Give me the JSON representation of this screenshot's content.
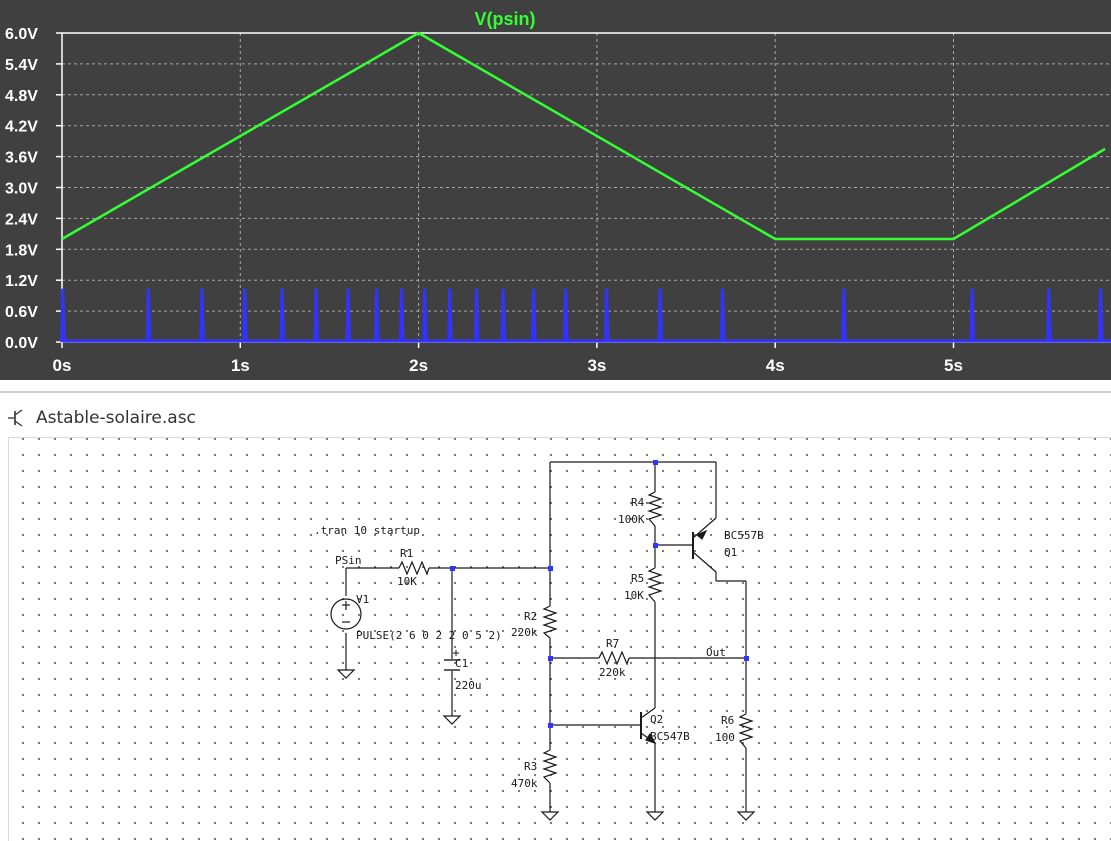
{
  "waveform_viewer": {
    "trace_title": "V(psin)",
    "background_color": "#404040",
    "trace_color": "#33ff33",
    "pulse_color": "#3333ff",
    "chart_data": {
      "type": "line",
      "title": "V(psin)",
      "xlabel": "",
      "ylabel": "",
      "xlim": [
        0,
        5.85
      ],
      "ylim": [
        0,
        6.0
      ],
      "grid": true,
      "x_ticks": [
        "0s",
        "1s",
        "2s",
        "3s",
        "4s",
        "5s"
      ],
      "x_tick_values": [
        0,
        1,
        2,
        3,
        4,
        5
      ],
      "y_ticks": [
        "0.0V",
        "0.6V",
        "1.2V",
        "1.8V",
        "2.4V",
        "3.0V",
        "3.6V",
        "4.2V",
        "4.8V",
        "5.4V",
        "6.0V"
      ],
      "y_tick_values": [
        0,
        0.6,
        1.2,
        1.8,
        2.4,
        3.0,
        3.6,
        4.2,
        4.8,
        5.4,
        6.0
      ],
      "series": [
        {
          "name": "V(psin)",
          "x": [
            0,
            2,
            4,
            5,
            5.85
          ],
          "y": [
            2.0,
            6.0,
            2.0,
            2.0,
            3.75
          ]
        }
      ],
      "pulse_series": {
        "x": [
          0.0,
          0.48,
          0.78,
          1.02,
          1.23,
          1.42,
          1.6,
          1.76,
          1.9,
          2.03,
          2.17,
          2.32,
          2.47,
          2.64,
          2.82,
          3.05,
          3.35,
          3.7,
          4.38,
          5.1,
          5.53,
          5.82
        ],
        "height": 1.02
      }
    }
  },
  "schematic": {
    "file_name": "Astable-solaire.asc",
    "directive": ".tran 10 startup",
    "labels": {
      "psin": "PSin",
      "out": "Out",
      "r1": "R1",
      "r1_val": "10K",
      "r2": "R2",
      "r2_val": "220k",
      "r3": "R3",
      "r3_val": "470k",
      "r4": "R4",
      "r4_val": "100K",
      "r5": "R5",
      "r5_val": "10K",
      "r6": "R6",
      "r6_val": "100",
      "r7": "R7",
      "r7_val": "220k",
      "c1": "C1",
      "c1_val": "220u",
      "v1": "V1",
      "v1_val": "PULSE(2 6 0 2 2 0 5 2)",
      "q1": "Q1",
      "q1_model": "BC557B",
      "q2": "Q2",
      "q2_model": "BC547B"
    }
  }
}
